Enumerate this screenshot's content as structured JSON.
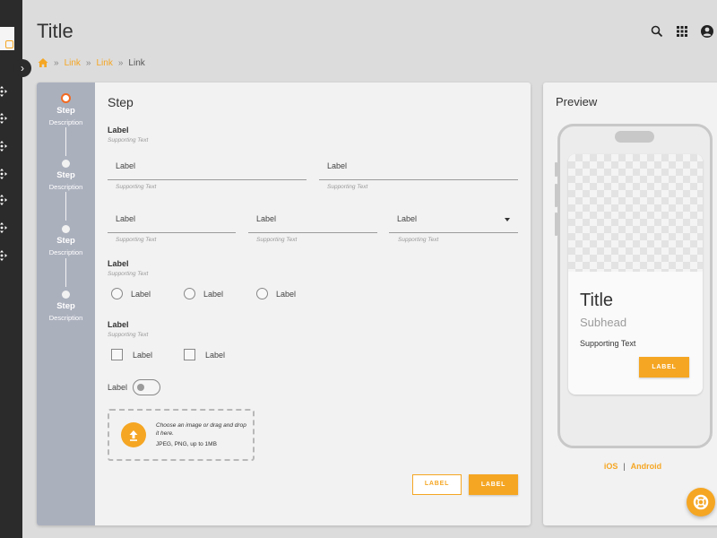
{
  "header": {
    "title": "Title",
    "icons": [
      "search-icon",
      "apps-grid-icon",
      "account-icon"
    ]
  },
  "breadcrumb": {
    "home_icon": "home-icon",
    "items": [
      "Link",
      "Link",
      "Link"
    ],
    "separator": "»"
  },
  "rail": {
    "toggle_glyph": "›",
    "item_icons": [
      "move-icon",
      "move-icon",
      "move-icon",
      "move-icon",
      "move-icon",
      "move-icon",
      "move-icon"
    ]
  },
  "stepper": {
    "steps": [
      {
        "label": "Step",
        "description": "Description",
        "active": true
      },
      {
        "label": "Step",
        "description": "Description",
        "active": false
      },
      {
        "label": "Step",
        "description": "Description",
        "active": false
      },
      {
        "label": "Step",
        "description": "Description",
        "active": false
      }
    ]
  },
  "form": {
    "title": "Step",
    "group1": {
      "label": "Label",
      "supporting": "Supporting Text"
    },
    "row1": [
      {
        "value": "Label",
        "supporting": "Supporting Text"
      },
      {
        "value": "Label",
        "supporting": "Supporting Text"
      }
    ],
    "row2": [
      {
        "value": "Label",
        "supporting": "Supporting Text"
      },
      {
        "value": "Label",
        "supporting": "Supporting Text"
      },
      {
        "value": "Label",
        "supporting": "Supporting Text",
        "dropdown": true
      }
    ],
    "radio_group": {
      "label": "Label",
      "supporting": "Supporting Text",
      "options": [
        "Label",
        "Label",
        "Label"
      ]
    },
    "checkbox_group": {
      "label": "Label",
      "supporting": "Supporting Text",
      "options": [
        "Label",
        "Label"
      ]
    },
    "toggle": {
      "label": "Label",
      "on": false
    },
    "upload": {
      "instruction": "Choose an image or drag and drop it here.",
      "hint": "JPEG, PNG, up to 1MB"
    },
    "secondary_button": "LABEL",
    "primary_button": "LABEL"
  },
  "preview": {
    "title": "Preview",
    "phone": {
      "title": "Title",
      "subhead": "Subhead",
      "supporting": "Supporting Text",
      "button": "LABEL"
    },
    "platforms": [
      "iOS",
      "Android"
    ],
    "separator": "|"
  },
  "fab_icon": "help-lifebuoy-icon",
  "colors": {
    "accent": "#f5a623",
    "active_step": "#f26a21",
    "rail": "#2b2b2b",
    "stepper": "#abb0bd"
  }
}
